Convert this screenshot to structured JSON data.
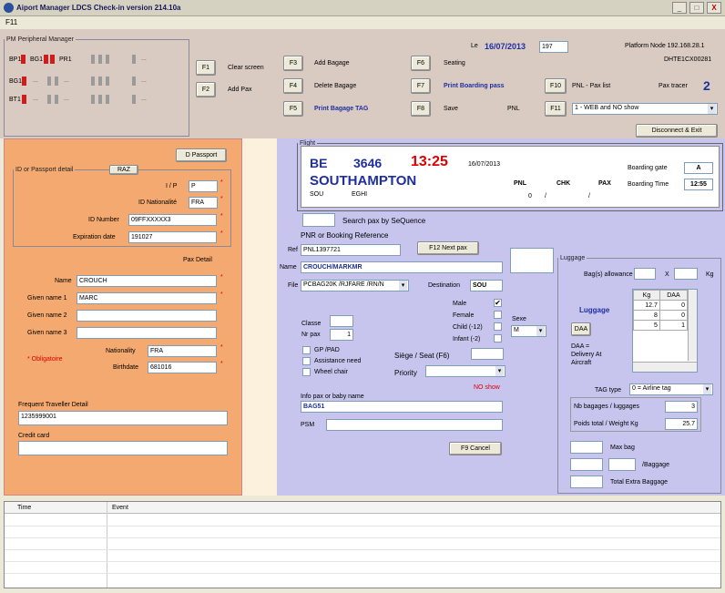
{
  "window": {
    "title": "Aiport Manager LDCS Check-in version 214.10a",
    "min": "_",
    "max": "□",
    "close": "X"
  },
  "menu": {
    "item1": "F11"
  },
  "peripheral": {
    "title": "PM Peripheral Manager",
    "bp1": "BP1",
    "bg1": "BG1",
    "pr1": "PR1",
    "bg1b": "BG1",
    "bt1": "BT1",
    "dots": "..."
  },
  "fkeys": {
    "f1": "F1",
    "f1_label": "Clear screen",
    "f2": "F2",
    "f2_label": "Add Pax",
    "f3": "F3",
    "f3_label": "Add Bagage",
    "f4": "F4",
    "f4_label": "Delete Bagage",
    "f5": "F5",
    "f5_label": "Print Bagage TAG",
    "f6": "F6",
    "f6_label": "Seating",
    "f7": "F7",
    "f7_label": "Print Boarding pass",
    "f8": "F8",
    "f8_label": "Save",
    "pnl": "PNL",
    "f10": "F10",
    "f10_label": "PNL - Pax list",
    "f11": "F11",
    "f11_select": "1 - WEB and NO show"
  },
  "header": {
    "date_prefix": "Le",
    "date": "16/07/2013",
    "counter": "197",
    "platform_label": "Platform Node 192.168.28.1",
    "node_id": "DHTE1CX00281",
    "pax_tracer_label": "Pax tracer",
    "pax_tracer_value": "2",
    "disconnect": "Disconnect & Exit"
  },
  "passport": {
    "btn": "D Passport",
    "legend": "ID or Passport detail",
    "raz": "RAZ",
    "ip_label": "I / P",
    "ip_value": "P",
    "nat_label": "ID Nationalité",
    "nat_value": "FRA",
    "idnum_label": "ID Number",
    "idnum_value": "09FFXXXXX3",
    "exp_label": "Expiration date",
    "exp_value": "191027",
    "paxdetail": "Pax Detail",
    "name_label": "Name",
    "name_value": "CROUCH",
    "given1_label": "Given name 1",
    "given1_value": "MARC",
    "given2_label": "Given name 2",
    "given2_value": "",
    "given3_label": "Given name 3",
    "given3_value": "",
    "nationality_label": "Nationality",
    "nationality_value": "FRA",
    "birth_label": "Birthdate",
    "birth_value": "681016",
    "obligatoire": "* Obligatoire",
    "star": "*",
    "ftd_label": "Frequent Traveller Detail",
    "ftd_value": "1235999001",
    "cc_label": "Credit card",
    "cc_value": ""
  },
  "flight": {
    "legend": "Flight",
    "airline": "BE",
    "number": "3646",
    "time": "13:25",
    "date": "16/07/2013",
    "city": "SOUTHAMPTON",
    "code1": "SOU",
    "code2": "EGHI",
    "pnl_label": "PNL",
    "chk_label": "CHK",
    "pax_label": "PAX",
    "pnl_value": "0",
    "slash1": "/",
    "slash2": "/",
    "gate_label": "Boarding gate",
    "gate_value": "A",
    "btime_label": "Boarding Time",
    "btime_value": "12:55"
  },
  "pax": {
    "search_label": "Search pax by SeQuence",
    "pnr_label": "PNR or Booking Reference",
    "ref_label": "Ref",
    "ref_value": "PNL1397721",
    "next_btn": "F12 Next pax",
    "name_label": "Name",
    "name_value": "CROUCH/MARKMR",
    "file_label": "File",
    "file_value": "PCBAG20K /RJFARE /RN/N",
    "dest_label": "Destination",
    "dest_value": "SOU",
    "male": "Male",
    "female": "Female",
    "child": "Child (-12)",
    "infant": "Infant (-2)",
    "sexe_label": "Sexe",
    "sexe_value": "M",
    "classe_label": "Classe",
    "nbpax_label": "Nr pax",
    "nbpax_value": "1",
    "gp_label": "GP /PAD",
    "assist_label": "Assistance need",
    "wheel_label": "Wheel chair",
    "siege_label": "Siège / Seat (F6)",
    "priority_label": "Priority",
    "noshow": "NO show",
    "info_label": "Info pax or baby name",
    "info_value": "BAG51",
    "psm_label": "PSM",
    "psm_value": "",
    "cancel_btn": "F9 Cancel",
    "check_mark": "✔"
  },
  "luggage": {
    "legend": "Luggage",
    "allow_label": "Bag(s) allowance",
    "x_label": "X",
    "kg_label": "Kg",
    "luggage_label": "Luggage",
    "col_kg": "Kg",
    "col_daa": "DAA",
    "rows": [
      [
        "12.7",
        "0"
      ],
      [
        "8",
        "0"
      ],
      [
        "5",
        "1"
      ]
    ],
    "daa_btn": "DAA",
    "daa_note1": "DAA =",
    "daa_note2": "Delivery At",
    "daa_note3": "Aircraft",
    "tag_label": "TAG type",
    "tag_value": "0 = Airline tag",
    "nb_label": "Nb bagages / luggages",
    "nb_value": "3",
    "weight_label": "Poids total / Weight Kg",
    "weight_value": "25.7",
    "maxbag_label": "Max bag",
    "perbag_label": "/Baggage",
    "extra_label": "Total Extra Baggage"
  },
  "log": {
    "col_time": "Time",
    "col_event": "Event"
  }
}
